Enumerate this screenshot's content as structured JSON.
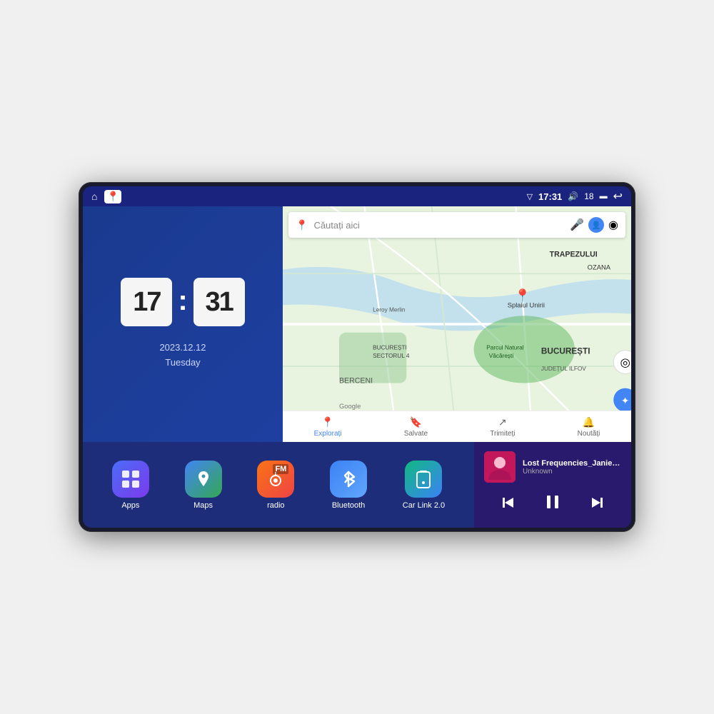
{
  "device": {
    "screen": {
      "status_bar": {
        "left_icons": [
          "home",
          "maps-pin"
        ],
        "time": "17:31",
        "volume_icon": "🔊",
        "battery_level": "18",
        "battery_icon": "🔋",
        "back_icon": "↩"
      },
      "clock": {
        "hours": "17",
        "minutes": "31",
        "date": "2023.12.12",
        "day": "Tuesday"
      },
      "map": {
        "search_placeholder": "Căutați aici",
        "bottom_items": [
          {
            "label": "Explorați",
            "active": true
          },
          {
            "label": "Salvate",
            "active": false
          },
          {
            "label": "Trimiteți",
            "active": false
          },
          {
            "label": "Noutăți",
            "active": false
          }
        ]
      },
      "apps": [
        {
          "label": "Apps",
          "icon": "⊞",
          "bg_class": "apps-bg"
        },
        {
          "label": "Maps",
          "icon": "📍",
          "bg_class": "maps-bg"
        },
        {
          "label": "radio",
          "icon": "📻",
          "bg_class": "radio-bg"
        },
        {
          "label": "Bluetooth",
          "icon": "🔵",
          "bg_class": "bt-bg"
        },
        {
          "label": "Car Link 2.0",
          "icon": "📱",
          "bg_class": "carlink-bg"
        }
      ],
      "music": {
        "title": "Lost Frequencies_Janieck Devy-...",
        "artist": "Unknown",
        "controls": {
          "prev": "⏮",
          "play": "⏸",
          "next": "⏭"
        }
      }
    }
  }
}
